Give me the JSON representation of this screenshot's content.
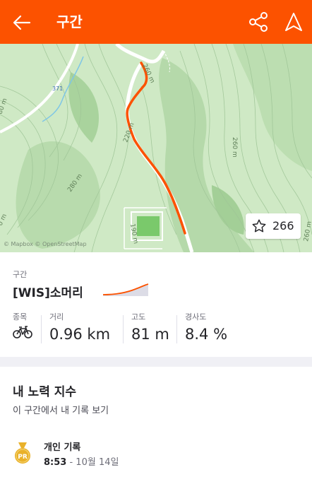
{
  "header": {
    "title": "구간",
    "back_icon": "back-arrow-icon",
    "share_icon": "share-icon",
    "navigate_icon": "navigation-arrow-icon"
  },
  "map": {
    "contour_labels": [
      "260 m",
      "260 m",
      "220 m",
      "280 m",
      "190 m",
      "80 m",
      "0 m",
      "260 m"
    ],
    "road_label": "371",
    "attribution": "© Mapbox © OpenStreetMap",
    "star_count": "266"
  },
  "segment": {
    "section_label": "구간",
    "name": "[WIS]소머리",
    "stats": {
      "sport_label": "종목",
      "sport_icon": "bike-icon",
      "distance_label": "거리",
      "distance_value": "0.96 km",
      "elevation_label": "고도",
      "elevation_value": "81 m",
      "grade_label": "경사도",
      "grade_value": "8.4 %"
    }
  },
  "effort": {
    "title": "내 노력 지수",
    "subtitle": "이 구간에서 내 기록 보기",
    "pr_badge": "PR",
    "pr_title": "개인 기록",
    "pr_time": "8:53",
    "pr_date": "- 10월 14일"
  },
  "colors": {
    "brand": "#fc5200",
    "route": "#fc5200",
    "map_green": "#cde8c4",
    "pr_gold": "#e9b12a"
  }
}
